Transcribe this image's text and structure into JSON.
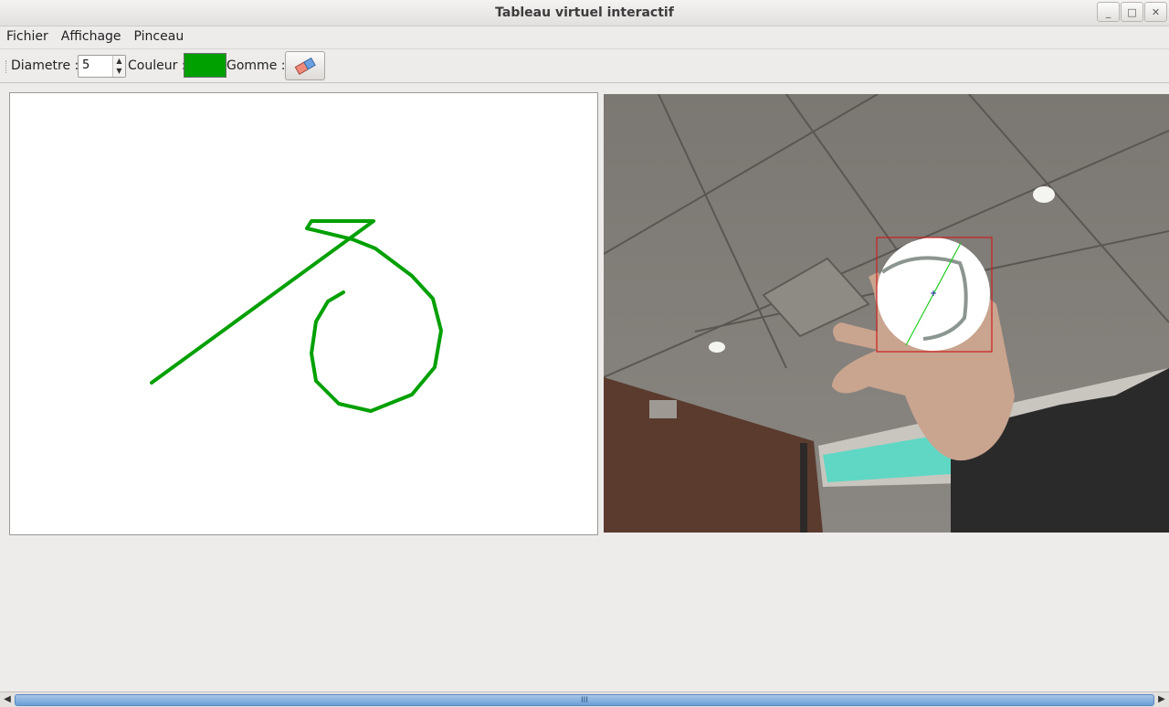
{
  "window": {
    "title": "Tableau virtuel interactif"
  },
  "menu": {
    "items": [
      "Fichier",
      "Affichage",
      "Pinceau"
    ]
  },
  "toolbar": {
    "diameter_label": "Diametre :",
    "diameter_value": "5",
    "color_label": "Couleur :",
    "color_value": "#00a000",
    "eraser_label": "Gomme :",
    "eraser_icon": "eraser-icon"
  },
  "canvas": {
    "background": "#ffffff",
    "stroke_color": "#00a000"
  },
  "camera": {
    "tracking_box_color": "#cc2020",
    "tracking_line_color": "#22cc22"
  },
  "scrollbar": {
    "grip": "III"
  }
}
